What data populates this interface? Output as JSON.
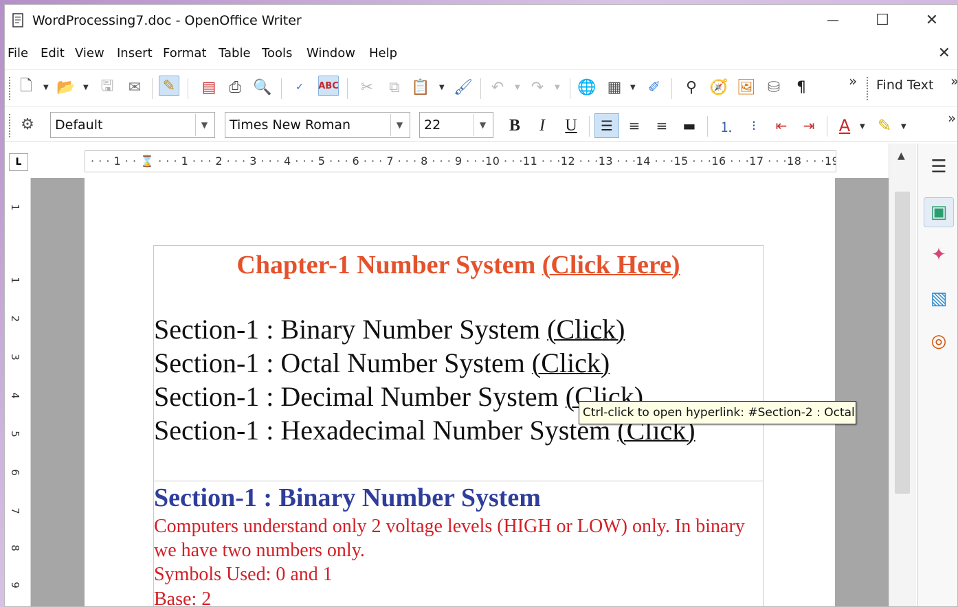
{
  "window": {
    "title": "WordProcessing7.doc - OpenOffice Writer",
    "minimize_glyph": "—",
    "maximize_glyph": "☐",
    "close_glyph": "✕"
  },
  "menu": {
    "items": [
      "File",
      "Edit",
      "View",
      "Insert",
      "Format",
      "Table",
      "Tools",
      "Window",
      "Help"
    ],
    "close_glyph": "✕"
  },
  "toolbar": {
    "find_text_label": "Find Text",
    "overflow_glyph": "»"
  },
  "formatting": {
    "paragraph_style": "Default",
    "font_name": "Times New Roman",
    "font_size": "22",
    "bold_label": "B",
    "italic_label": "I",
    "underline_label": "U"
  },
  "ruler": {
    "corner_label": "L",
    "text": "· · · 1 · · ⌛ · · · 1 · · · 2 · · · 3 · · · 4 · · · 5 · · · 6 · · · 7 · · · 8 · · · 9 · · ·10 · · ·11 · · ·12 · · ·13 · · ·14 · · ·15 · · ·16 · · ·17 · · ·18 · · ·19 ·",
    "vertical_marks": [
      "1",
      "1",
      "2",
      "3",
      "4",
      "5",
      "6",
      "7",
      "8",
      "9"
    ]
  },
  "document": {
    "chapter_text": "Chapter-1 Number System ",
    "chapter_link": "(Click Here)",
    "sections": [
      {
        "text": "Section-1 : Binary Number System ",
        "link": "(Click)"
      },
      {
        "text": "Section-1 : Octal Number System ",
        "link": "(Click)"
      },
      {
        "text": "Section-1 : Decimal Number System ",
        "link": "(Click)"
      },
      {
        "text": "Section-1 : Hexadecimal Number System ",
        "link": "(Click)"
      }
    ],
    "binary_heading": "Section-1 : Binary Number System",
    "binary_para_line1": "Computers understand only 2 voltage levels (HIGH or LOW) only. In binary",
    "binary_para_line2": "we have two numbers only.",
    "symbols_used": "Symbols Used: 0 and 1",
    "base": "Base: 2"
  },
  "tooltip": {
    "text": "Ctrl-click to open hyperlink: #Section-2 : Octal"
  },
  "colors": {
    "chapter": "#e4522c",
    "heading_blue": "#2f3d9c",
    "body_red": "#d32027"
  }
}
